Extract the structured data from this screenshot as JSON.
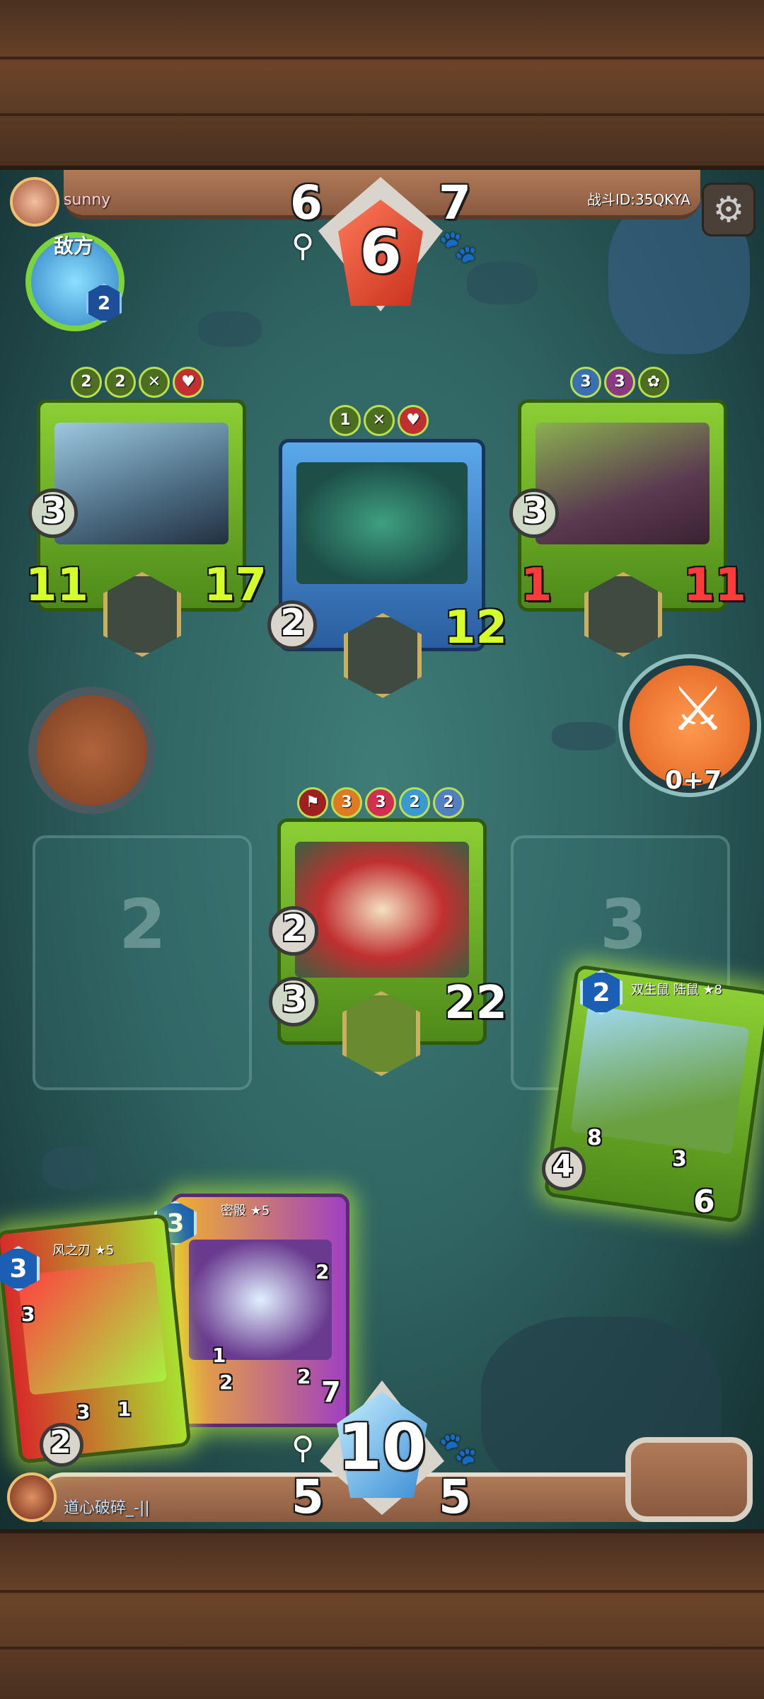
{
  "enemy": {
    "name": "sunny",
    "hero_label": "敌方",
    "hero_shield": "2",
    "stat_left": "6",
    "stat_right": "7",
    "gem": "6"
  },
  "battle_id": "战斗ID:35QKYA",
  "player": {
    "name": "道心破碎_-||",
    "stat_left": "5",
    "stat_right": "5",
    "gem": "10"
  },
  "enemy_cards": [
    {
      "badges": [
        "2",
        "2",
        "",
        ""
      ],
      "heal": "3",
      "attack": "11",
      "health": "17"
    },
    {
      "badges": [
        "1",
        "",
        ""
      ],
      "heal": "2",
      "health": "12"
    },
    {
      "badges": [
        "3",
        "3",
        ""
      ],
      "heal": "3",
      "attack": "1",
      "health": "11"
    }
  ],
  "player_board_card": {
    "badges": [
      "3",
      "3",
      "2",
      "2"
    ],
    "dice": "2",
    "heal": "3",
    "health": "22"
  },
  "slots": [
    "2",
    "3"
  ],
  "attack_button": {
    "label": "0+7"
  },
  "hand": [
    {
      "title": "风之刃 ★5",
      "cost": "3",
      "small": "3",
      "s1": "3",
      "s2": "1",
      "attack": "2"
    },
    {
      "title": "密骰 ★5",
      "cost": "3",
      "small": "2",
      "s1": "1",
      "s2": "2",
      "s3": "2",
      "shield": "7"
    },
    {
      "title": "双生鼠 陆鼠 ★8",
      "cost": "2",
      "s1": "8",
      "s2": "3",
      "attack": "4",
      "health": "6"
    }
  ]
}
